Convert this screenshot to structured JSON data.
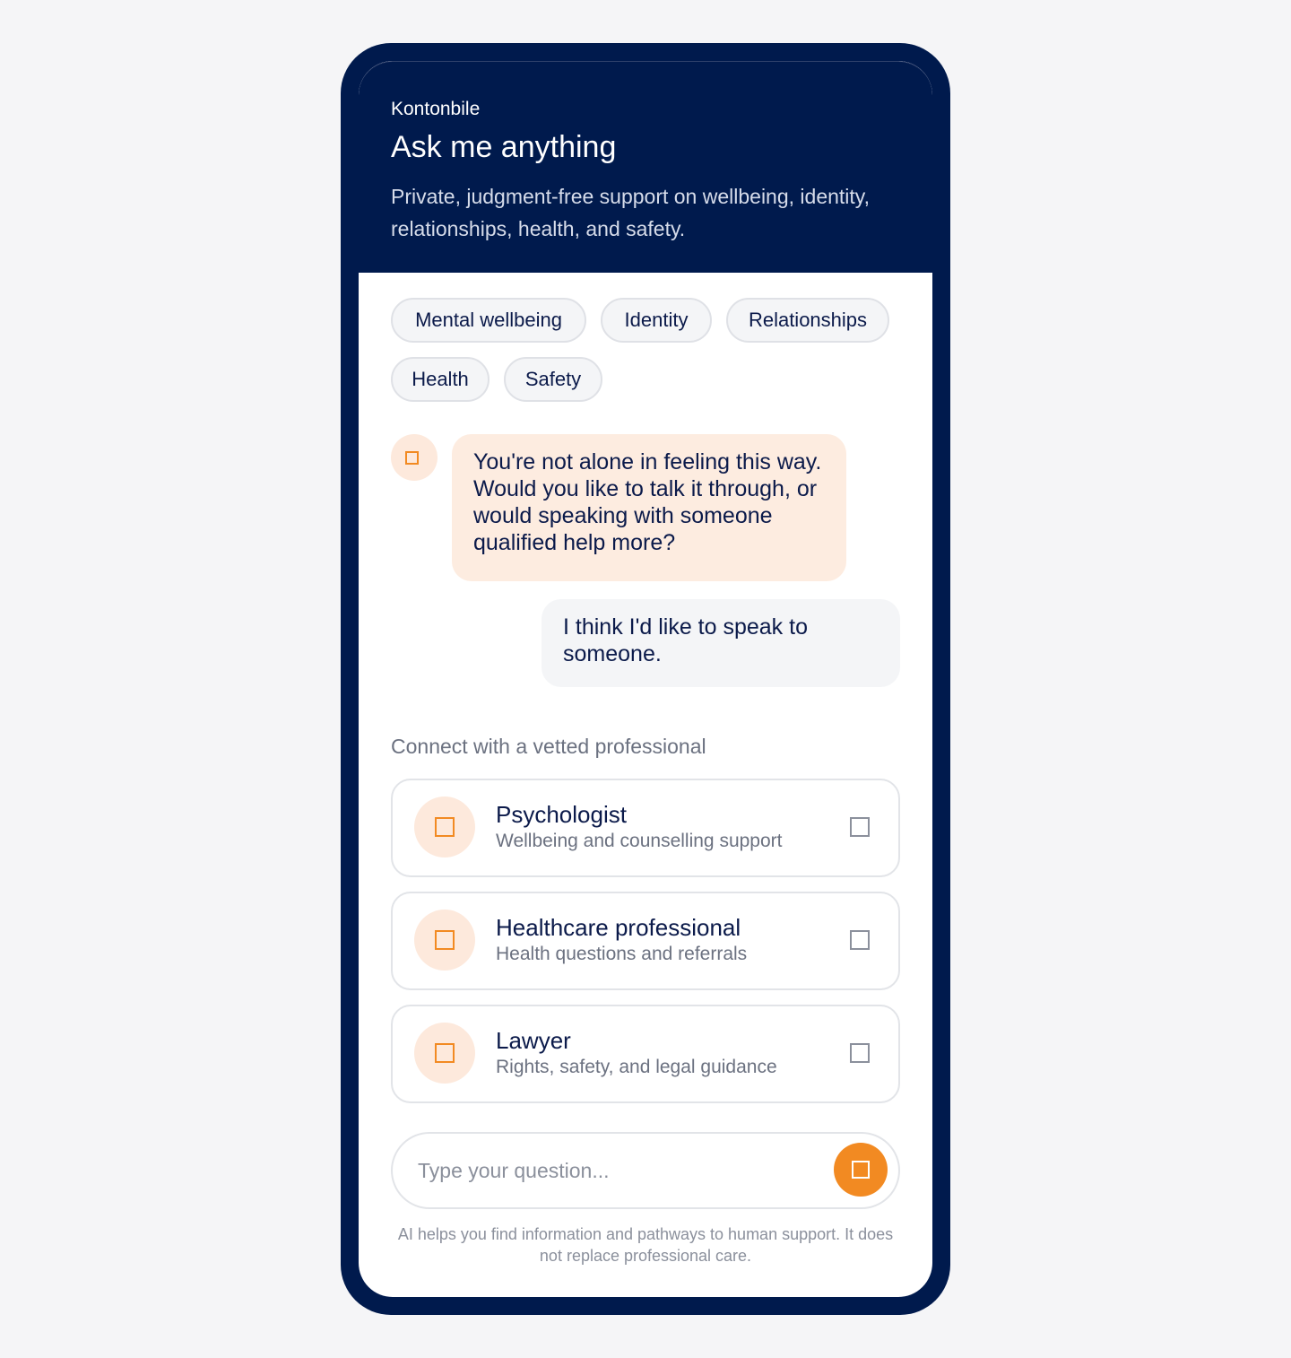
{
  "header": {
    "brand": "Kontonbile",
    "title": "Ask me anything",
    "subtitle": "Private, judgment-free support on wellbeing, identity, relationships, health, and safety."
  },
  "topics": [
    "Mental wellbeing",
    "Identity",
    "Relationships",
    "Health",
    "Safety"
  ],
  "chat": {
    "assistant_icon": "square-icon",
    "assistant_message": "You're not alone in feeling this way. Would you like to talk it through, or would speaking with someone qualified help more?",
    "user_message": "I think I'd like to speak to someone."
  },
  "professionals": {
    "heading": "Connect with a vetted professional",
    "items": [
      {
        "title": "Psychologist",
        "description": "Wellbeing and counselling support",
        "icon": "square-icon",
        "selected": false
      },
      {
        "title": "Healthcare professional",
        "description": "Health questions and referrals",
        "icon": "square-icon",
        "selected": false
      },
      {
        "title": "Lawyer",
        "description": "Rights, safety, and legal guidance",
        "icon": "square-icon",
        "selected": false
      }
    ]
  },
  "composer": {
    "placeholder": "Type your question...",
    "value": "",
    "send_icon": "send-icon"
  },
  "disclaimer": "AI helps you find information and pathways to human support. It does not replace professional care.",
  "colors": {
    "navy": "#001a4d",
    "accent_orange": "#f28a22",
    "accent_soft": "#fde9dc",
    "chip_bg": "#f4f5f7",
    "page_bg": "#f5f5f7"
  }
}
